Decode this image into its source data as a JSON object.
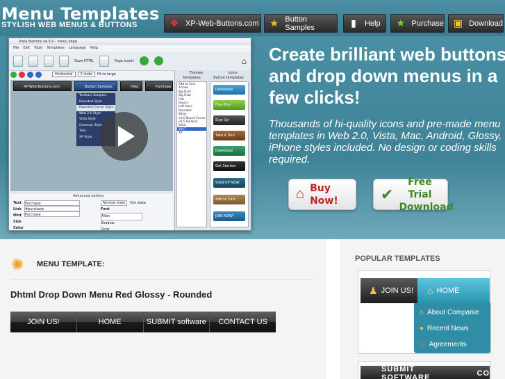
{
  "header": {
    "title": "Menu Templates",
    "subtitle": "STYLISH WEB MENUS & BUTTONS",
    "nav": [
      {
        "label": "XP-Web-Buttons.com",
        "icon": "xp-logo-icon"
      },
      {
        "label": "Button Samples",
        "icon": "star-icon"
      },
      {
        "label": "Help",
        "icon": "help-icon"
      },
      {
        "label": "Purchase",
        "icon": "star-icon"
      },
      {
        "label": "Download",
        "icon": "download-icon"
      }
    ]
  },
  "hero": {
    "headline": "Create brilliant web buttons and drop down menus in a few clicks!",
    "description": "Thousands of hi-quality icons and pre-made menu templates in Web 2.0, Vista, Mac, Android, Glossy, iPhone styles included. No design or coding skills required.",
    "buy_label": "Buy Now!",
    "trial_label": "Free Trial Download"
  },
  "app": {
    "title": "Vista Buttons v4.5.0 - menu.vbprj",
    "menu": [
      "File",
      "Edit",
      "Tools",
      "Templates",
      "Language",
      "Help"
    ],
    "toolbar": [
      "Save HTML",
      "Page insert"
    ],
    "orientation": "Horizontal",
    "state": "2 state",
    "fit": "Fit to large",
    "preview_buttons": [
      "XP-Web-Buttons.com",
      "Button Samples",
      "Help",
      "Purchase"
    ],
    "dropdown": [
      "Toolbars Samples",
      "Rounded Style",
      "Rounded Corner Style",
      "Web 2.0 Style",
      "Vista Style",
      "Common Style",
      "Tabs",
      "XP Style"
    ],
    "side_tabs": [
      "Themes",
      "Icons",
      "Templates",
      "Button templates"
    ],
    "templates": [
      "Add to Cart",
      "Arrows",
      "Big Dark",
      "Big Oval",
      "Flat",
      "Glossy",
      "Left Icons",
      "Rounded",
      "Shiny",
      "v4.5 Round Corner",
      "v4.5 Toolbars",
      "Vista",
      "Win7",
      "XP"
    ],
    "thumbs": [
      "Download",
      "Free Tour",
      "Sign Up",
      "Take A Tour",
      "Download",
      "Get Started",
      "SIGN UP NOW",
      "Add to Cart",
      "JOIN NOW!"
    ],
    "props": {
      "text_label": "Text",
      "text_value": "Purchase",
      "link_label": "Link",
      "link_value": "#purchase",
      "hint_label": "Hint",
      "hint_value": "Purchase",
      "size_label": "Size",
      "color_label": "Color",
      "icon_label": "Icon",
      "advanced": "Advanced options",
      "normal_state": "Normal state",
      "hot_state": "Hot state",
      "font_label": "Font",
      "font_value": "Allen",
      "shadow_label": "Shadow",
      "glow_label": "Glow"
    }
  },
  "main": {
    "section_label": "MENU TEMPLATE:",
    "demo_title": "Dhtml Drop Down Menu Red Glossy - Rounded",
    "demo_items": [
      "JOIN US!",
      "HOME",
      "SUBMIT software",
      "CONTACT US"
    ]
  },
  "popular": {
    "heading": "POPULAR TEMPLATES",
    "bar_items": [
      "JOIN US!",
      "HOME"
    ],
    "drop_items": [
      "About Companie",
      "Recent News",
      "Agreements"
    ],
    "bar2_items": [
      "SUBMIT SOFTWARE",
      "CO"
    ]
  },
  "colors": {
    "hero_bg": "#3f8398",
    "accent_orange": "#f2a321",
    "dropdown_teal": "#2f8ea5",
    "buy_red": "#c0231e",
    "trial_green": "#3b8a1e"
  }
}
